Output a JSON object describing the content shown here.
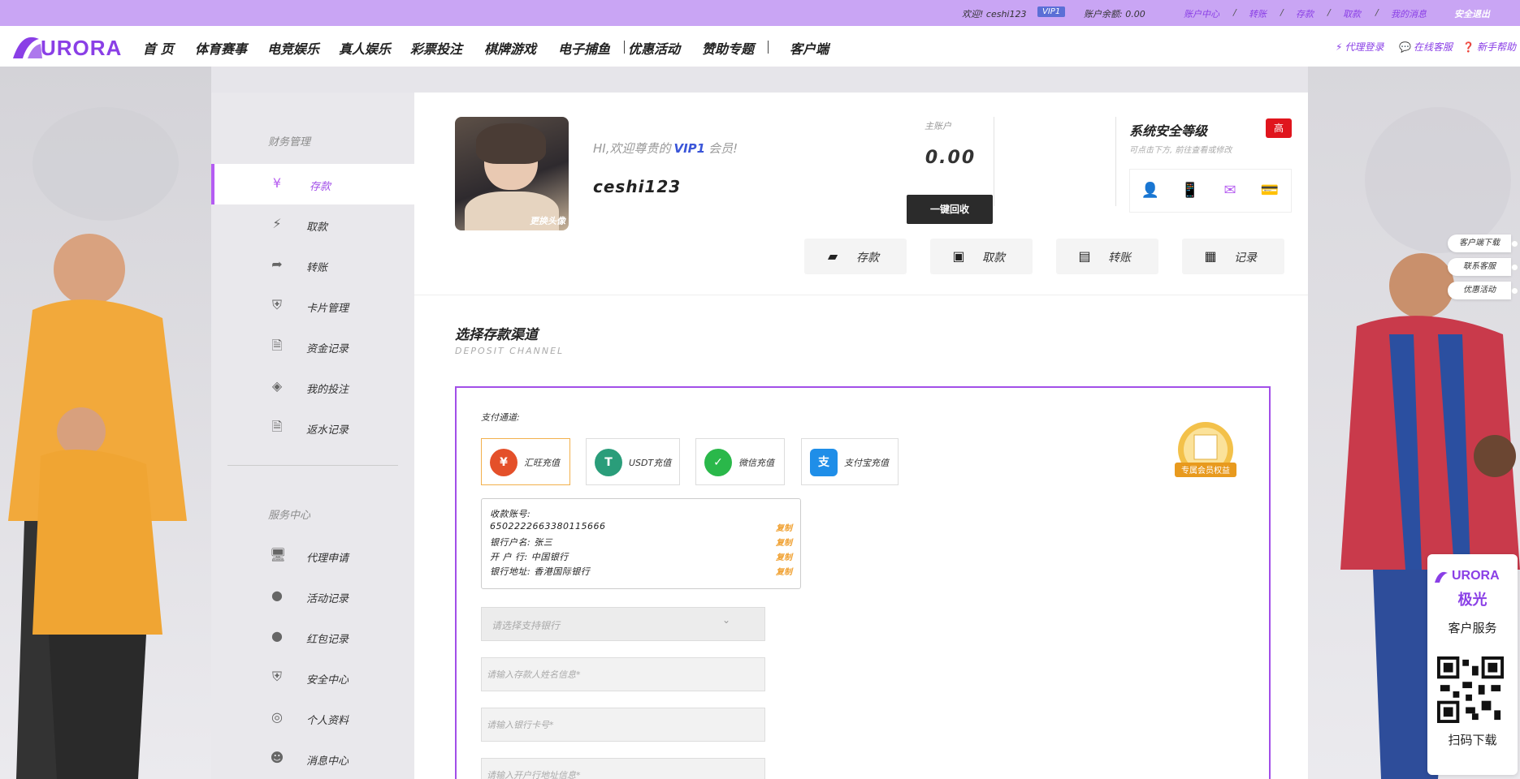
{
  "topbar": {
    "welcome": "欢迎! ceshi123",
    "vip": "VIP1",
    "balance": "账户余额: 0.00",
    "links": [
      "账户中心",
      "转账",
      "存款",
      "取款",
      "我的消息"
    ],
    "logout": "安全退出"
  },
  "nav": {
    "logo": "URORA",
    "items": [
      "首 页",
      "体育赛事",
      "电竞娱乐",
      "真人娱乐",
      "彩票投注",
      "棋牌游戏",
      "电子捕鱼",
      "优惠活动",
      "赞助专题",
      "客户端"
    ],
    "right": [
      "代理登录",
      "在线客服",
      "新手帮助"
    ]
  },
  "sidebar": {
    "finance_heading": "财务管理",
    "finance_items": [
      "存款",
      "取款",
      "转账",
      "卡片管理",
      "资金记录",
      "我的投注",
      "返水记录"
    ],
    "service_heading": "服务中心",
    "service_items": [
      "代理申请",
      "活动记录",
      "红包记录",
      "安全中心",
      "个人资料",
      "消息中心"
    ]
  },
  "profile": {
    "change_avatar": "更换头像",
    "greeting_prefix": "HI,欢迎尊贵的",
    "vip": "VIP1",
    "greeting_suffix": "会员!",
    "username": "ceshi123"
  },
  "account": {
    "label": "主账户",
    "value": "0.00",
    "recover": "一键回收"
  },
  "security": {
    "title": "系统安全等级",
    "badge": "高",
    "subtitle": "可点击下方, 前往查看或修改"
  },
  "actions": [
    "存款",
    "取款",
    "转账",
    "记录"
  ],
  "deposit": {
    "title": "选择存款渠道",
    "subtitle": "DEPOSIT CHANNEL",
    "channel_label": "支付通道:",
    "channels": [
      "汇旺充值",
      "USDT充值",
      "微信充值",
      "支付宝充值"
    ],
    "info": {
      "account_label": "收款账号:",
      "account_number": "6502222663380115666",
      "holder": "银行户名: 张三",
      "bank": "开 户 行: 中国银行",
      "address": "银行地址: 香港国际银行",
      "copy": "复制"
    },
    "bank_select": "请选择支持银行",
    "name_placeholder": "请输入存款人姓名信息*",
    "card_placeholder": "请输入银行卡号*",
    "address_placeholder": "请输入开户行地址信息*",
    "medal_label": "专属会员权益"
  },
  "float_tabs": [
    "客户端下载",
    "联系客服",
    "优惠活动"
  ],
  "qr_card": {
    "logo": "URORA",
    "cn": "极光",
    "title": "客户服务",
    "scan": "扫码下载"
  },
  "colors": {
    "accent": "#a24fe8",
    "topbar": "#c9a5f4",
    "badge_red": "#e0151d",
    "copy_orange": "#f0a030"
  }
}
